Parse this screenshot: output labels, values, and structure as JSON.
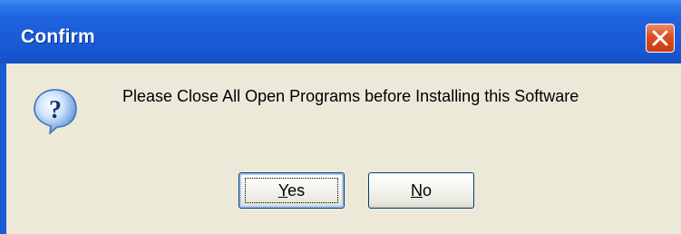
{
  "window": {
    "title": "Confirm"
  },
  "dialog": {
    "message": "Please Close All Open Programs before Installing this Software",
    "icon": "question-icon"
  },
  "buttons": {
    "yes": {
      "mnemonic": "Y",
      "rest": "es",
      "label": "Yes"
    },
    "no": {
      "mnemonic": "N",
      "rest": "o",
      "label": "No"
    }
  },
  "colors": {
    "titlebar": "#1a5cd8",
    "close_button": "#d9501f",
    "dialog_background": "#ece9d8",
    "button_border": "#003c74"
  }
}
